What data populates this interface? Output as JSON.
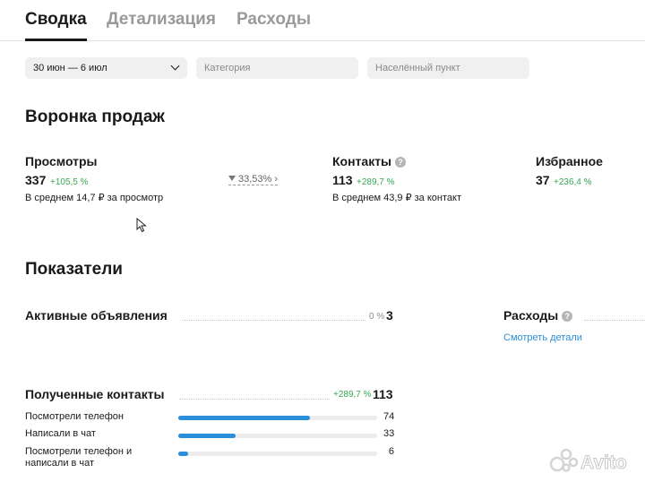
{
  "tabs": [
    {
      "label": "Сводка",
      "active": true
    },
    {
      "label": "Детализация",
      "active": false
    },
    {
      "label": "Расходы",
      "active": false
    }
  ],
  "filters": {
    "period": "30 июн — 6 июл",
    "category_placeholder": "Категория",
    "location_placeholder": "Населённый пункт"
  },
  "funnel": {
    "title": "Воронка продаж",
    "views": {
      "label": "Просмотры",
      "value": "337",
      "delta": "+105,5 %",
      "note": "В среднем 14,7 ₽ за просмотр"
    },
    "conversion": "33,53%",
    "contacts": {
      "label": "Контакты",
      "value": "113",
      "delta": "+289,7 %",
      "note": "В среднем 43,9 ₽ за контакт"
    },
    "favorites": {
      "label": "Избранное",
      "value": "37",
      "delta": "+236,4 %"
    }
  },
  "metrics": {
    "title": "Показатели",
    "active_ads": {
      "label": "Активные объявления",
      "pct": "0 %",
      "value": "3"
    },
    "expenses": {
      "label": "Расходы",
      "link": "Смотреть детали"
    },
    "contacts_received": {
      "label": "Полученные контакты",
      "delta": "+289,7 %",
      "value": "113",
      "rows": [
        {
          "label": "Посмотрели телефон",
          "value": "74",
          "fraction": 0.66
        },
        {
          "label": "Написали в чат",
          "value": "33",
          "fraction": 0.29
        },
        {
          "label": "Посмотрели телефон и написали в чат",
          "value": "6",
          "fraction": 0.05
        }
      ]
    }
  },
  "colors": {
    "accent": "#2a8fd8",
    "positive": "#3aa655"
  },
  "watermark": {
    "brand": "Avito"
  }
}
